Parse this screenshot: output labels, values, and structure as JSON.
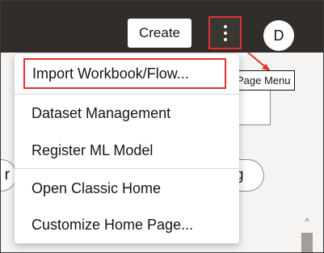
{
  "header": {
    "create_label": "Create",
    "page_menu_icon": "kebab-vertical-icon",
    "avatar_initial": "D"
  },
  "callout": {
    "label": "Page Menu",
    "color": "#e0312f"
  },
  "page_menu": {
    "items": [
      {
        "label": "Import Workbook/Flow..."
      },
      {
        "label": "Dataset Management"
      },
      {
        "label": "Register ML Model"
      },
      {
        "label": "Open Classic Home"
      },
      {
        "label": "Customize Home Page..."
      }
    ]
  },
  "background": {
    "pill_left_text": "r",
    "pill_right_text": "g"
  },
  "colors": {
    "topbar": "#312d2a",
    "highlight": "#e0312f",
    "page_background": "#f5f4f2"
  }
}
